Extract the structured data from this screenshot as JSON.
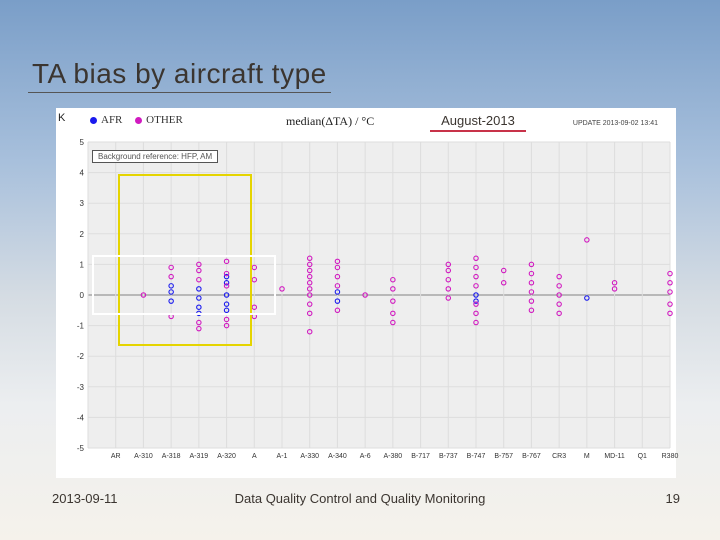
{
  "title": "TA bias by aircraft type",
  "month_label": "August-2013",
  "axis_title": "median(ΔTA) / °C",
  "update_text": "UPDATE 2013-09-02 13:41",
  "ref_text": "Background reference: HFP, AM",
  "header_K": "K",
  "legend": [
    {
      "label": "AFR",
      "color": "#1a1aee"
    },
    {
      "label": "OTHER",
      "color": "#d11ac0"
    }
  ],
  "footer": {
    "date": "2013-09-11",
    "center": "Data Quality Control and Quality Monitoring",
    "page": "19"
  },
  "chart_data": {
    "type": "scatter",
    "title": "TA bias by aircraft type — median(ΔTA) / °C — August-2013",
    "xlabel": "",
    "ylabel": "median(ΔTA) / °C",
    "ylim": [
      -5,
      5
    ],
    "x_ticks_numeric": [
      0,
      1,
      2,
      3,
      4,
      5,
      6,
      7,
      8,
      9,
      10,
      11,
      12,
      13,
      14,
      15,
      16,
      17,
      18,
      19,
      20,
      21
    ],
    "x_labels": [
      "",
      "AR",
      "A-310",
      "A-318",
      "A-319",
      "A-320",
      "A",
      "A-1",
      "A-330",
      "A-340",
      "A-6",
      "A-380",
      "B-717",
      "B-737",
      "B-747",
      "B-757",
      "B-767",
      "CR3",
      "M",
      "MD-11",
      "Q1",
      "R380"
    ],
    "series": [
      {
        "name": "AFR",
        "color": "#1a1aee",
        "points": [
          {
            "x": 3,
            "y": 0.1
          },
          {
            "x": 3,
            "y": -0.2
          },
          {
            "x": 3,
            "y": 0.3
          },
          {
            "x": 4,
            "y": -0.4
          },
          {
            "x": 4,
            "y": -0.1
          },
          {
            "x": 4,
            "y": 0.2
          },
          {
            "x": 4,
            "y": -0.6
          },
          {
            "x": 5,
            "y": 0.0
          },
          {
            "x": 5,
            "y": -0.3
          },
          {
            "x": 5,
            "y": 0.4
          },
          {
            "x": 5,
            "y": -0.5
          },
          {
            "x": 5,
            "y": 0.6
          },
          {
            "x": 9,
            "y": -0.2
          },
          {
            "x": 9,
            "y": 0.1
          },
          {
            "x": 14,
            "y": 0.0
          },
          {
            "x": 14,
            "y": -0.2
          },
          {
            "x": 18,
            "y": -0.1
          }
        ]
      },
      {
        "name": "OTHER",
        "color": "#d11ac0",
        "points": [
          {
            "x": 2,
            "y": 0.0
          },
          {
            "x": 3,
            "y": 0.6
          },
          {
            "x": 3,
            "y": 0.9
          },
          {
            "x": 3,
            "y": -0.7
          },
          {
            "x": 4,
            "y": 0.8
          },
          {
            "x": 4,
            "y": 1.0
          },
          {
            "x": 4,
            "y": 0.5
          },
          {
            "x": 4,
            "y": -0.9
          },
          {
            "x": 4,
            "y": -1.1
          },
          {
            "x": 5,
            "y": 0.7
          },
          {
            "x": 5,
            "y": 1.1
          },
          {
            "x": 5,
            "y": -0.8
          },
          {
            "x": 5,
            "y": -1.0
          },
          {
            "x": 5,
            "y": 0.3
          },
          {
            "x": 6,
            "y": 0.9
          },
          {
            "x": 6,
            "y": 0.5
          },
          {
            "x": 6,
            "y": -0.4
          },
          {
            "x": 6,
            "y": -0.7
          },
          {
            "x": 7,
            "y": 0.2
          },
          {
            "x": 8,
            "y": 1.2
          },
          {
            "x": 8,
            "y": 1.0
          },
          {
            "x": 8,
            "y": 0.8
          },
          {
            "x": 8,
            "y": 0.6
          },
          {
            "x": 8,
            "y": 0.4
          },
          {
            "x": 8,
            "y": 0.2
          },
          {
            "x": 8,
            "y": 0.0
          },
          {
            "x": 8,
            "y": -0.3
          },
          {
            "x": 8,
            "y": -0.6
          },
          {
            "x": 8,
            "y": -1.2
          },
          {
            "x": 9,
            "y": 1.1
          },
          {
            "x": 9,
            "y": 0.9
          },
          {
            "x": 9,
            "y": 0.6
          },
          {
            "x": 9,
            "y": 0.3
          },
          {
            "x": 9,
            "y": -0.5
          },
          {
            "x": 10,
            "y": 0.0
          },
          {
            "x": 11,
            "y": 0.5
          },
          {
            "x": 11,
            "y": 0.2
          },
          {
            "x": 11,
            "y": -0.2
          },
          {
            "x": 11,
            "y": -0.6
          },
          {
            "x": 11,
            "y": -0.9
          },
          {
            "x": 13,
            "y": 1.0
          },
          {
            "x": 13,
            "y": 0.8
          },
          {
            "x": 13,
            "y": 0.5
          },
          {
            "x": 13,
            "y": 0.2
          },
          {
            "x": 13,
            "y": -0.1
          },
          {
            "x": 14,
            "y": 1.2
          },
          {
            "x": 14,
            "y": 0.9
          },
          {
            "x": 14,
            "y": 0.6
          },
          {
            "x": 14,
            "y": 0.3
          },
          {
            "x": 14,
            "y": -0.3
          },
          {
            "x": 14,
            "y": -0.6
          },
          {
            "x": 14,
            "y": -0.9
          },
          {
            "x": 15,
            "y": 0.8
          },
          {
            "x": 15,
            "y": 0.4
          },
          {
            "x": 16,
            "y": 1.0
          },
          {
            "x": 16,
            "y": 0.7
          },
          {
            "x": 16,
            "y": 0.4
          },
          {
            "x": 16,
            "y": 0.1
          },
          {
            "x": 16,
            "y": -0.2
          },
          {
            "x": 16,
            "y": -0.5
          },
          {
            "x": 17,
            "y": 0.6
          },
          {
            "x": 17,
            "y": 0.3
          },
          {
            "x": 17,
            "y": 0.0
          },
          {
            "x": 17,
            "y": -0.3
          },
          {
            "x": 17,
            "y": -0.6
          },
          {
            "x": 18,
            "y": 1.8
          },
          {
            "x": 19,
            "y": 0.4
          },
          {
            "x": 19,
            "y": 0.2
          },
          {
            "x": 21,
            "y": 0.7
          },
          {
            "x": 21,
            "y": 0.4
          },
          {
            "x": 21,
            "y": 0.1
          },
          {
            "x": 21,
            "y": -0.3
          },
          {
            "x": 21,
            "y": -0.6
          }
        ]
      }
    ]
  }
}
